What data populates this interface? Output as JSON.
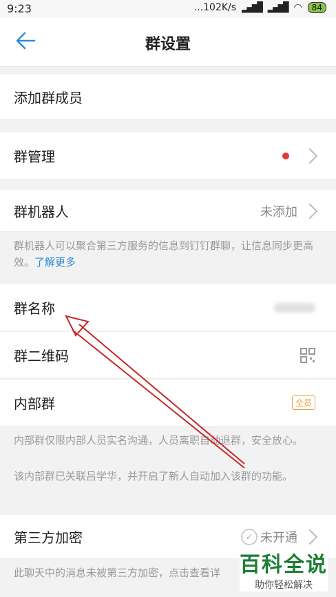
{
  "status": {
    "time": "9:23",
    "speed": "...102K/s",
    "battery": "84"
  },
  "topbar": {
    "title": "群设置"
  },
  "rows": {
    "add_member": "添加群成员",
    "manage": "群管理",
    "robot": {
      "label": "群机器人",
      "value": "未添加"
    },
    "robot_desc": "群机器人可以聚合第三方服务的信息到钉钉群聊，让信息同步更高效。",
    "robot_link": "了解更多",
    "group_name": "群名称",
    "qrcode": "群二维码",
    "internal": {
      "label": "内部群",
      "badge": "全员"
    },
    "internal_desc1": "内部群仅限内部人员实名沟通，人员离职自动退群，安全放心。",
    "internal_desc2": "该内部群已关联吕学华，并开启了新人自动加入该群的功能。",
    "encrypt": {
      "label": "第三方加密",
      "value": "未开通"
    },
    "encrypt_desc": "此聊天中的消息未被第三方加密，点击查看详"
  },
  "watermark": {
    "big": "百科全说",
    "small": "助你轻松解决"
  },
  "colors": {
    "accent": "#2d8ad9",
    "red_dot": "#e53935",
    "arrow": "#c62828"
  }
}
